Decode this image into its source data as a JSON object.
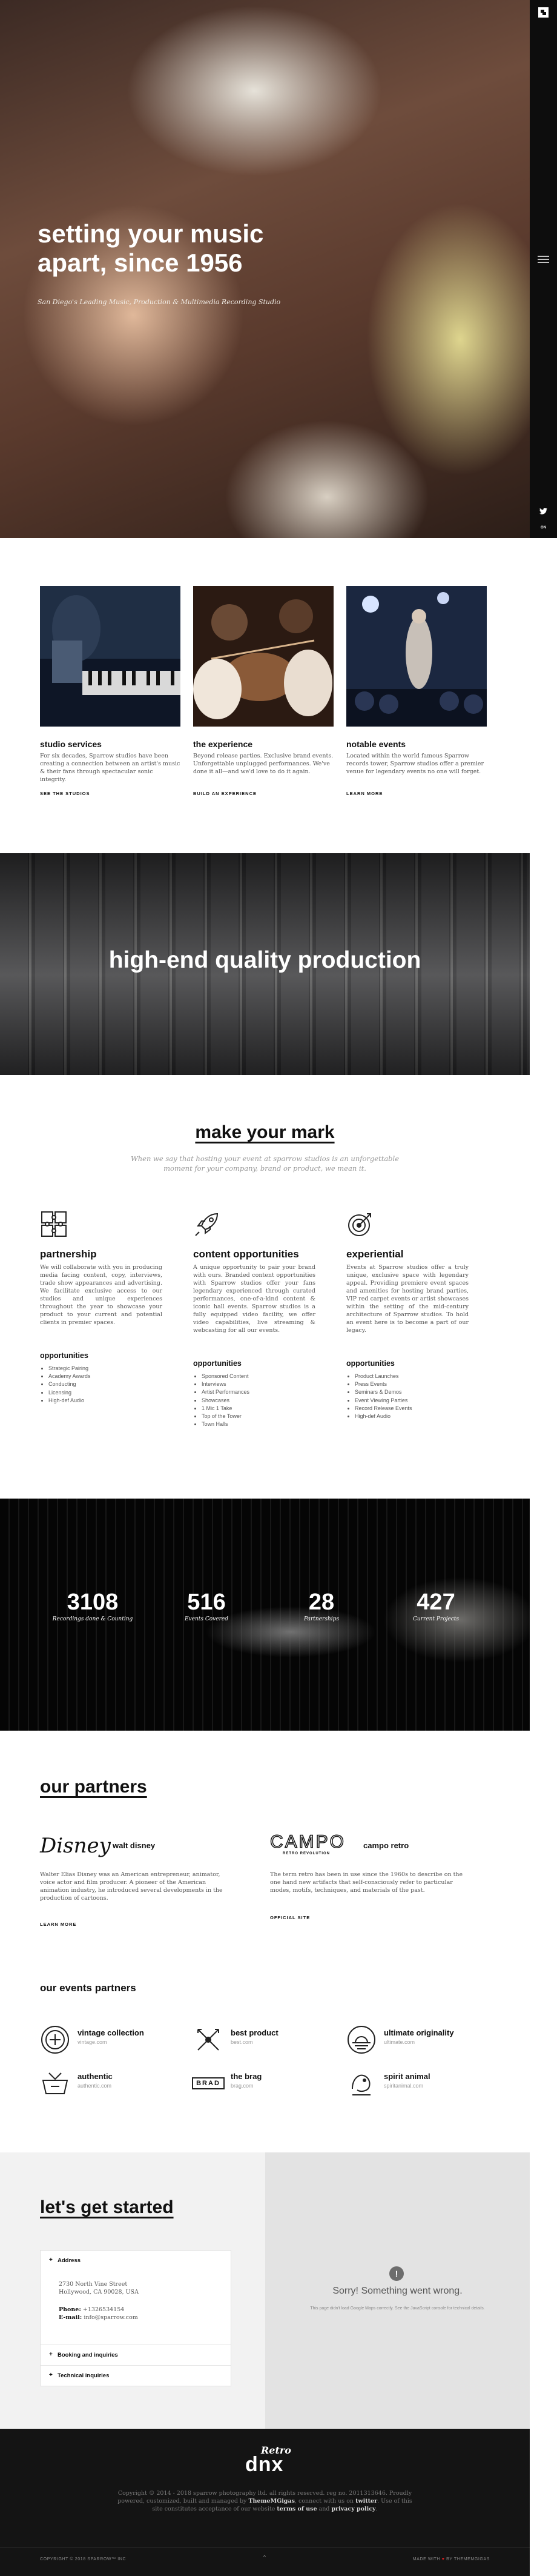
{
  "hero": {
    "title_line1": "setting your music",
    "title_line2": "apart, since 1956",
    "subtitle": "San Diego's Leading Music, Production & Multimedia Recording Studio"
  },
  "sidebar": {
    "logo_icon": "brand-logo-icon",
    "menu_icon": "hamburger-menu-icon",
    "twitter_icon": "twitter-icon",
    "social_label": "ON"
  },
  "features": [
    {
      "title": "studio services",
      "text": "For six decades, Sparrow studios have been creating a connection between an artist's music & their fans through spectacular sonic integrity.",
      "link": "SEE THE STUDIOS"
    },
    {
      "title": "the experience",
      "text": "Beyond release parties. Exclusive brand events. Unforgettable unplugged performances. We've done it all—and we'd love to do it again.",
      "link": "BUILD AN EXPERIENCE"
    },
    {
      "title": "notable events",
      "text": "Located within the world famous Sparrow records tower, Sparrow studios offer a premier venue for legendary events no one will forget.",
      "link": "LEARN MORE"
    }
  ],
  "banner": {
    "title": "high-end quality production"
  },
  "mark": {
    "title": "make your mark",
    "subtitle": "When we say that hosting your event at sparrow studios is an unforgettable moment for your company, brand or product, we mean it."
  },
  "columns": [
    {
      "icon": "puzzle-icon",
      "title": "partnership",
      "text": "We will collaborate with you in producing media facing content, copy, interviews, trade show appearances and advertising. We facilitate exclusive access to our studios and unique experiences throughout the year to showcase your product to your current and potential clients in premier spaces.",
      "sub": "opportunities",
      "items": [
        "Strategic Pairing",
        "Academy Awards",
        "Conducting",
        "Licensing",
        "High-def Audio"
      ]
    },
    {
      "icon": "rocket-icon",
      "title": "content opportunities",
      "text": "A unique opportunity to pair your brand with ours. Branded content opportunities with Sparrow studios offer your fans legendary experienced through curated performances, one-of-a-kind content & iconic hall events. Sparrow studios is a fully equipped video facility, we offer video capabilities, live streaming & webcasting for all our events.",
      "sub": "opportunities",
      "items": [
        "Sponsored Content",
        "Interviews",
        "Artist Performances",
        "Showcases",
        "1 Mic 1 Take",
        "Top of the Tower",
        "Town Halls"
      ]
    },
    {
      "icon": "target-icon",
      "title": "experiential",
      "text": "Events at Sparrow studios offer a truly unique, exclusive space with legendary appeal. Providing premiere event spaces and amenities for hosting brand parties, VIP red carpet events or artist showcases within the setting of the mid-century architecture of Sparrow studios. To hold an event here is to become a part of our legacy.",
      "sub": "opportunities",
      "items": [
        "Product Launches",
        "Press Events",
        "Seminars & Demos",
        "Event Viewing Parties",
        "Record Release Events",
        "High-def Audio"
      ]
    }
  ],
  "stats": [
    {
      "number": "3108",
      "label": "Recordings done & Counting"
    },
    {
      "number": "516",
      "label": "Events Covered"
    },
    {
      "number": "28",
      "label": "Partnerships"
    },
    {
      "number": "427",
      "label": "Current Projects"
    }
  ],
  "partners": {
    "title": "our partners",
    "items": [
      {
        "logo": "Disney",
        "name": "walt disney",
        "text": "Walter Elias Disney was an American entrepreneur, animator, voice actor and film producer. A pioneer of the American animation industry, he introduced several developments in the production of cartoons.",
        "link": "LEARN MORE"
      },
      {
        "logo": "CAMPO",
        "logo_sub": "RETRO REVOLUTION",
        "name": "campo retro",
        "text": "The term retro has been in use since the 1960s to describe on the one hand new artifacts that self-consciously refer to particular modes, motifs, techniques, and materials of the past.",
        "link": "OFFICIAL SITE"
      }
    ]
  },
  "event_partners": {
    "title": "our events partners",
    "items": [
      {
        "icon": "vintage-badge-icon",
        "name": "vintage collection",
        "url": "vintage.com"
      },
      {
        "icon": "crossed-arrows-icon",
        "name": "best product",
        "url": "best.com"
      },
      {
        "icon": "sunrise-badge-icon",
        "name": "ultimate originality",
        "url": "ultimate.com"
      },
      {
        "icon": "authentic-badge-icon",
        "name": "authentic",
        "url": "authentic.com"
      },
      {
        "icon": "brad-badge-icon",
        "badge_text": "BRAD",
        "name": "the brag",
        "url": "brag.com"
      },
      {
        "icon": "spirit-animal-icon",
        "name": "spirit animal",
        "url": "spiritanimal.com"
      }
    ]
  },
  "contact": {
    "title": "let's get started",
    "sections": [
      {
        "title": "Address",
        "street": "2730 North Vine Street",
        "city": "Hollywood, CA 90028, USA",
        "phone_label": "Phone:",
        "phone": "+1326534154",
        "email_label": "E-mail:",
        "email": "info@sparrow.com"
      },
      {
        "title": "Booking and inquiries"
      },
      {
        "title": "Technical inquiries"
      }
    ]
  },
  "map": {
    "error_title": "Sorry! Something went wrong.",
    "error_text": "This page didn't load Google Maps correctly. See the JavaScript console for technical details."
  },
  "footer": {
    "logo_script": "Retro",
    "logo_main": "dnx",
    "text_1": "Copyright © 2014 - 2018 sparrow photography ltd. all rights reserved. reg no. 2011313646. Proudly powered, customized, built and managed by",
    "brand": "ThemeMGigas",
    "text_2": ", connect with us on",
    "social": "twitter",
    "text_3": ". Use of this site constitutes acceptance of our website",
    "terms": "terms of use",
    "and": "and",
    "privacy": "privacy policy",
    "copyright": "COPYRIGHT © 2018 SPARROW™ INC",
    "made_prefix": "MADE WITH",
    "made_suffix": "BY THEMEMGIGAS"
  }
}
